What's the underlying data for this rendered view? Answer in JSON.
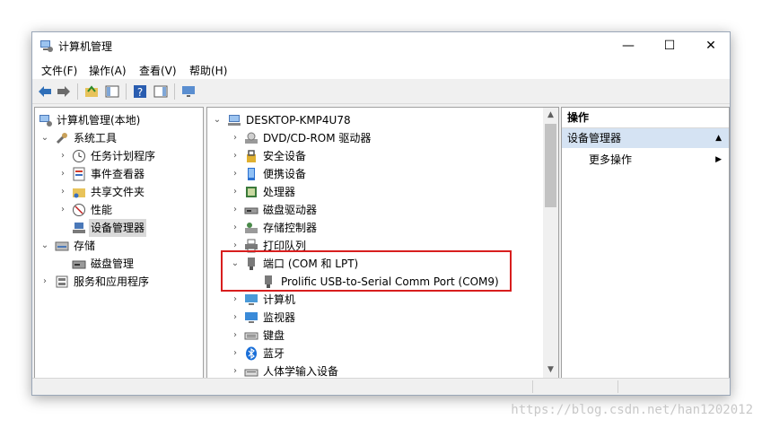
{
  "window": {
    "title": "计算机管理",
    "controls": {
      "minimize": "—",
      "maximize": "☐",
      "close": "✕"
    }
  },
  "menu": [
    "文件(F)",
    "操作(A)",
    "查看(V)",
    "帮助(H)"
  ],
  "left_tree": [
    {
      "label": "计算机管理(本地)",
      "icon": "computer-management-icon"
    },
    {
      "label": "系统工具",
      "icon": "tools-icon"
    },
    {
      "label": "任务计划程序",
      "icon": "clock-icon"
    },
    {
      "label": "事件查看器",
      "icon": "event-viewer-icon"
    },
    {
      "label": "共享文件夹",
      "icon": "shared-folder-icon"
    },
    {
      "label": "性能",
      "icon": "performance-icon"
    },
    {
      "label": "设备管理器",
      "icon": "device-manager-icon"
    },
    {
      "label": "存储",
      "icon": "storage-icon"
    },
    {
      "label": "磁盘管理",
      "icon": "disk-management-icon"
    },
    {
      "label": "服务和应用程序",
      "icon": "services-icon"
    }
  ],
  "device_tree": {
    "root": "DESKTOP-KMP4U78",
    "items": [
      {
        "label": "DVD/CD-ROM 驱动器",
        "icon": "dvd-drive-icon"
      },
      {
        "label": "安全设备",
        "icon": "security-device-icon"
      },
      {
        "label": "便携设备",
        "icon": "portable-device-icon"
      },
      {
        "label": "处理器",
        "icon": "processor-icon"
      },
      {
        "label": "磁盘驱动器",
        "icon": "disk-drive-icon"
      },
      {
        "label": "存储控制器",
        "icon": "storage-controller-icon"
      },
      {
        "label": "打印队列",
        "icon": "printer-icon"
      },
      {
        "label": "端口 (COM 和 LPT)",
        "icon": "port-icon"
      },
      {
        "label": "Prolific USB-to-Serial Comm Port (COM9)",
        "icon": "port-icon"
      },
      {
        "label": "计算机",
        "icon": "computer-icon"
      },
      {
        "label": "监视器",
        "icon": "monitor-icon"
      },
      {
        "label": "键盘",
        "icon": "keyboard-icon"
      },
      {
        "label": "蓝牙",
        "icon": "bluetooth-icon"
      },
      {
        "label": "人体学输入设备",
        "icon": "hid-icon"
      }
    ]
  },
  "actions": {
    "header": "操作",
    "section": "设备管理器",
    "more": "更多操作"
  },
  "watermark": "https://blog.csdn.net/han1202012",
  "colors": {
    "highlight_border": "#d81e1e",
    "selection": "#d9d9d9",
    "actions_section_bg": "#d5e3f3"
  }
}
